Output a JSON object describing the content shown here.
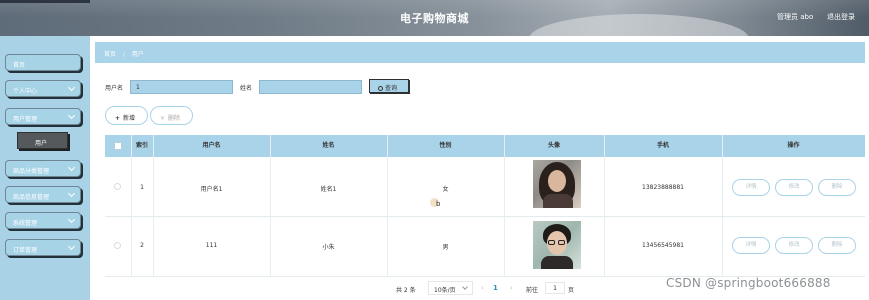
{
  "header": {
    "title": "电子购物商城",
    "admin": "管理员 abo",
    "logout": "退出登录"
  },
  "sidebar": {
    "items": [
      {
        "label": "首页",
        "expandable": false
      },
      {
        "label": "个人中心",
        "expandable": true
      },
      {
        "label": "用户管理",
        "expandable": true
      },
      {
        "label": "商品分类管理",
        "expandable": true
      },
      {
        "label": "商品信息管理",
        "expandable": true
      },
      {
        "label": "系统管理",
        "expandable": true
      },
      {
        "label": "订单管理",
        "expandable": true
      }
    ],
    "subitem": "用户"
  },
  "breadcrumb": {
    "home": "首页",
    "separator": "/",
    "current": "用户"
  },
  "search": {
    "username_label": "用户名",
    "username_value": "1",
    "name_label": "姓名",
    "name_value": "",
    "query_label": "查询"
  },
  "actions": {
    "add": "新增",
    "delete": "删除"
  },
  "table": {
    "headers": [
      "索引",
      "用户名",
      "姓名",
      "性别",
      "头像",
      "手机",
      "操作"
    ],
    "rows": [
      {
        "index": "1",
        "username": "用户名1",
        "name": "姓名1",
        "gender": "女",
        "avatar": "avatar-woman",
        "phone": "13823888881",
        "buttons": [
          "详情",
          "修改",
          "删除"
        ]
      },
      {
        "index": "2",
        "username": "111",
        "name": "小朱",
        "gender": "男",
        "avatar": "avatar-man-glasses",
        "phone": "13456545981",
        "buttons": [
          "详情",
          "修改",
          "删除"
        ]
      }
    ]
  },
  "pagination": {
    "total": "共 2 条",
    "page_size": "10条/页",
    "prev": "‹",
    "current_page": "1",
    "next": "›",
    "goto_label": "前往",
    "goto_value": "1",
    "page_suffix": "页"
  },
  "overlay": {
    "watermark": "CSDN @springboot666888",
    "cursor_text": "b"
  },
  "colors": {
    "accent": "#a9d3e8",
    "sidebar": "#aad2e6",
    "active_submenu": "#55595c",
    "page_active": "#2f8dc0"
  }
}
